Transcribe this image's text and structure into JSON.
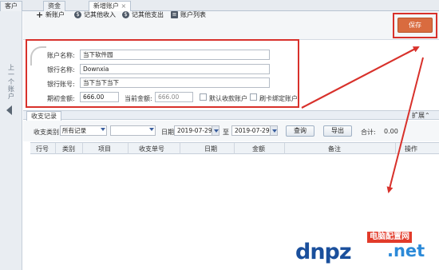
{
  "tabs": [
    {
      "label": "客户"
    },
    {
      "label": "资金"
    },
    {
      "label": "新增账户"
    }
  ],
  "left_panel": {
    "label": "上一个账户"
  },
  "toolbar": {
    "new_account": "新账户",
    "other_income": "记其他收入",
    "other_expense": "记其他支出",
    "account_list": "账户列表",
    "save": "保存"
  },
  "form": {
    "account_name_label": "账户名称:",
    "account_name_value": "当下软件园",
    "bank_name_label": "银行名称:",
    "bank_name_value": "Downxia",
    "bank_account_label": "银行账号:",
    "bank_account_value": "当下当下当下",
    "opening_balance_label": "期初金额:",
    "opening_balance_value": "666.00",
    "current_balance_label": "当前金额:",
    "current_balance_value": "666.00",
    "default_receipt_label": "默认收款账户",
    "card_bind_label": "刷卡绑定账户"
  },
  "records": {
    "tab_label": "收支记录",
    "expand_label": "扩展",
    "type_label": "收支类别",
    "type_value": "所有记录",
    "second_select_value": "",
    "date_label": "日期",
    "date_from": "2019-07-29",
    "to_label": "至",
    "date_to": "2019-07-29",
    "query_button": "查询",
    "export_button": "导出",
    "total_label": "合计:",
    "total_value": "0.00",
    "columns": [
      "行号",
      "类别",
      "项目",
      "收支单号",
      "日期",
      "金额",
      "备注",
      "操作"
    ]
  },
  "watermark": {
    "brand": "dnpz",
    "tagline": "电脑配置网",
    "suffix": ".net"
  },
  "colors": {
    "annotation_red": "#d8312b",
    "save_button": "#d96b3f",
    "watermark_blue": "#1a4f9c"
  }
}
